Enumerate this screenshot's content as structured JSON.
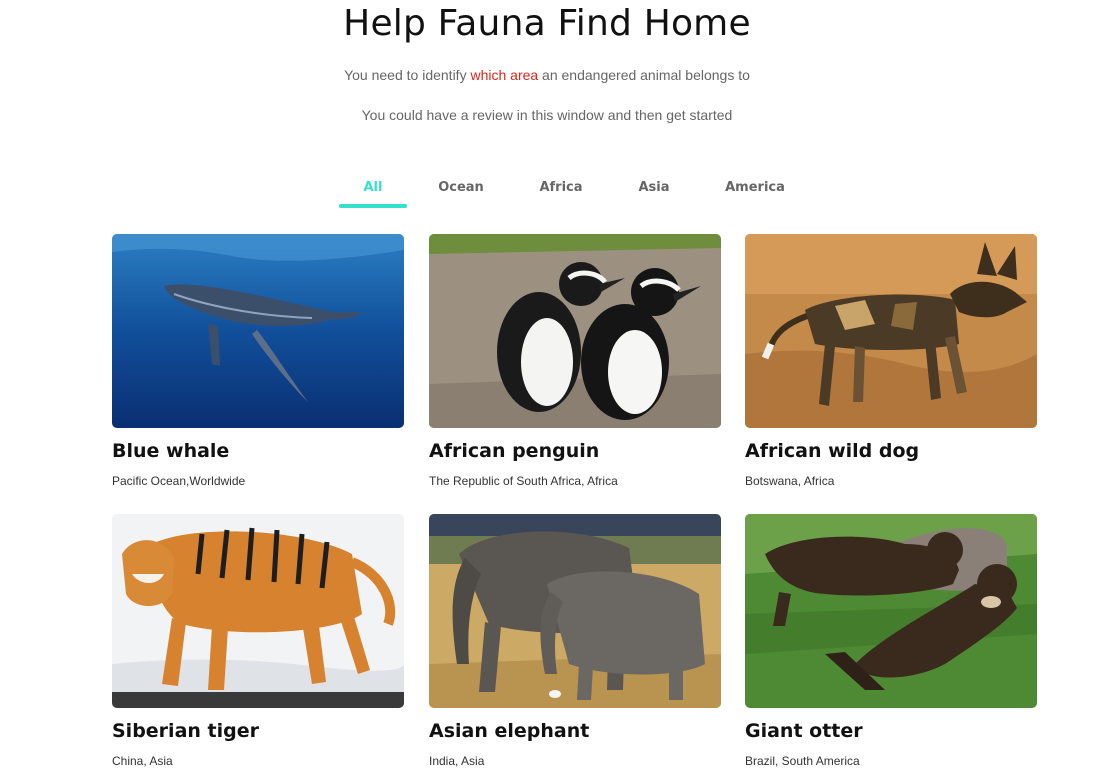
{
  "header": {
    "title": "Help Fauna Find Home",
    "line1_before": "You need to identify ",
    "line1_highlight": "which area",
    "line1_after": " an endangered animal belongs to",
    "line2": "You could have a review in this window and then get started",
    "highlight_color": "#e0261b"
  },
  "tabs": [
    {
      "label": "All",
      "active": true
    },
    {
      "label": "Ocean",
      "active": false
    },
    {
      "label": "Africa",
      "active": false
    },
    {
      "label": "Asia",
      "active": false
    },
    {
      "label": "America",
      "active": false
    }
  ],
  "accent_color": "#35e0cd",
  "animals": [
    {
      "name": "Blue whale",
      "location": "Pacific Ocean,Worldwide",
      "image": "whale-photo"
    },
    {
      "name": "African penguin",
      "location": "The Republic of South Africa, Africa",
      "image": "penguin-photo"
    },
    {
      "name": "African wild dog",
      "location": "Botswana, Africa",
      "image": "wild-dog-photo"
    },
    {
      "name": "Siberian tiger",
      "location": "China, Asia",
      "image": "tiger-photo"
    },
    {
      "name": "Asian elephant",
      "location": "India, Asia",
      "image": "elephant-photo"
    },
    {
      "name": "Giant otter",
      "location": "Brazil, South America",
      "image": "otter-photo"
    }
  ]
}
